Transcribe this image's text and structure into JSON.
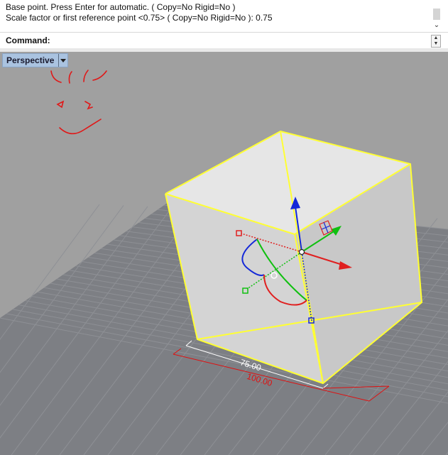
{
  "command_history": {
    "lines": [
      "Base point. Press Enter for automatic. ( Copy=No  Rigid=No )",
      "Scale factor or first reference point <0.75> ( Copy=No  Rigid=No ): 0.75"
    ]
  },
  "command_line": {
    "label": "Command:",
    "value": ""
  },
  "viewport": {
    "title": "Perspective",
    "dimensions": {
      "inner_label": "75.00",
      "outer_label": "100.00"
    }
  },
  "colors": {
    "viewport_background": "#a0a0a0",
    "grid_plane": "#7d7f84",
    "grid_lines": "#8e9095",
    "cube_edges": "#ffff33",
    "cube_fill": "#dcdcdc",
    "dimension_inner": "#ffffff",
    "dimension_outer": "#e01010",
    "gizmo_x": "#e02020",
    "gizmo_y": "#10c010",
    "gizmo_z": "#1428d8",
    "sketch_annotation": "#e01818",
    "viewport_tab": "#aac3e0"
  },
  "icons": [
    "scroll-down-icon",
    "spinner-up-icon",
    "spinner-down-icon",
    "viewport-menu-icon"
  ]
}
